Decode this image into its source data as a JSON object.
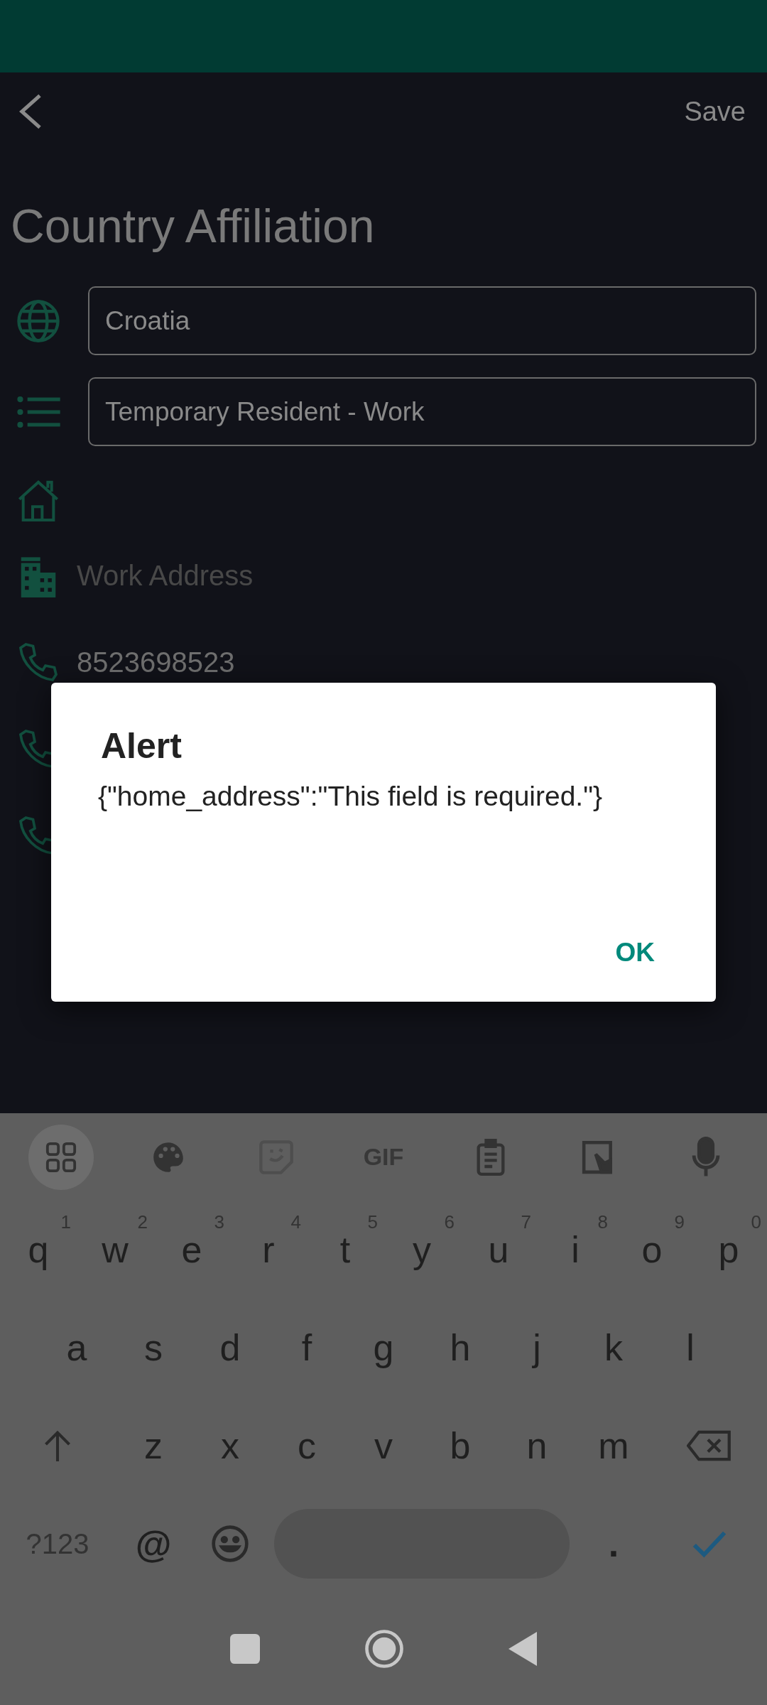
{
  "app_bar": {
    "action": "Save"
  },
  "title": "Country Affiliation",
  "form": [
    {
      "kind": "field",
      "value": "Croatia"
    },
    {
      "kind": "field",
      "value": "Temporary Resident - Work"
    },
    {
      "kind": "empty"
    },
    {
      "kind": "text",
      "placeholder": "Work Address"
    },
    {
      "kind": "text",
      "value": "8523698523"
    },
    {
      "kind": "empty"
    },
    {
      "kind": "empty"
    }
  ],
  "dialog": {
    "title": "Alert",
    "message": "{\"home_address\":\"This field is required.\"}",
    "buttons": [
      "OK"
    ]
  },
  "keyboard": {
    "toolbar_label": "GIF",
    "rows": [
      [
        {
          "kind": "letter",
          "label": "q",
          "hint": "1"
        },
        {
          "kind": "letter",
          "label": "w",
          "hint": "2"
        },
        {
          "kind": "letter",
          "label": "e",
          "hint": "3"
        },
        {
          "kind": "letter",
          "label": "r",
          "hint": "4"
        },
        {
          "kind": "letter",
          "label": "t",
          "hint": "5"
        },
        {
          "kind": "letter",
          "label": "y",
          "hint": "6"
        },
        {
          "kind": "letter",
          "label": "u",
          "hint": "7"
        },
        {
          "kind": "letter",
          "label": "i",
          "hint": "8"
        },
        {
          "kind": "letter",
          "label": "o",
          "hint": "9"
        },
        {
          "kind": "letter",
          "label": "p",
          "hint": "0"
        }
      ],
      [
        {
          "kind": "letter",
          "label": "a"
        },
        {
          "kind": "letter",
          "label": "s"
        },
        {
          "kind": "letter",
          "label": "d"
        },
        {
          "kind": "letter",
          "label": "f"
        },
        {
          "kind": "letter",
          "label": "g"
        },
        {
          "kind": "letter",
          "label": "h"
        },
        {
          "kind": "letter",
          "label": "j"
        },
        {
          "kind": "letter",
          "label": "k"
        },
        {
          "kind": "letter",
          "label": "l"
        }
      ],
      [
        {
          "kind": "shift"
        },
        {
          "kind": "letter",
          "label": "z"
        },
        {
          "kind": "letter",
          "label": "x"
        },
        {
          "kind": "letter",
          "label": "c"
        },
        {
          "kind": "letter",
          "label": "v"
        },
        {
          "kind": "letter",
          "label": "b"
        },
        {
          "kind": "letter",
          "label": "n"
        },
        {
          "kind": "letter",
          "label": "m"
        },
        {
          "kind": "backspace"
        }
      ]
    ],
    "bottom_row": [
      {
        "kind": "symbols",
        "label": "?123"
      },
      {
        "kind": "letter",
        "label": "@"
      },
      {
        "kind": "emoji"
      },
      {
        "kind": "space"
      },
      {
        "kind": "letter",
        "label": "."
      },
      {
        "kind": "enter"
      }
    ]
  }
}
